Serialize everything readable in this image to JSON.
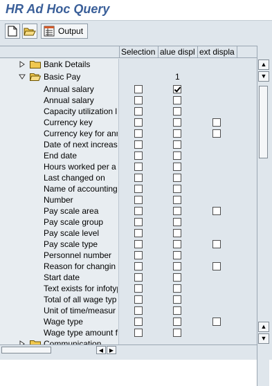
{
  "window": {
    "title": "HR Ad Hoc Query"
  },
  "toolbar": {
    "new_icon": "new-document-icon",
    "open_icon": "open-folder-icon",
    "output_icon": "output-list-icon",
    "output_label": "Output"
  },
  "columns": {
    "selection": "Selection",
    "value_display": "alue displ",
    "text_display": "ext displa"
  },
  "tree": {
    "bank_details": "Bank Details",
    "basic_pay": "Basic Pay",
    "basic_pay_count": "1",
    "communication": "Communication"
  },
  "fields": [
    {
      "label": "Annual salary",
      "selection": false,
      "value": true,
      "text": null
    },
    {
      "label": "Annual salary",
      "selection": false,
      "value": false,
      "text": null
    },
    {
      "label": "Capacity utilization l",
      "selection": false,
      "value": false,
      "text": null
    },
    {
      "label": "Currency key",
      "selection": false,
      "value": false,
      "text": false
    },
    {
      "label": "Currency key for ann",
      "selection": false,
      "value": false,
      "text": false
    },
    {
      "label": "Date of next increas",
      "selection": false,
      "value": false,
      "text": null
    },
    {
      "label": "End date",
      "selection": false,
      "value": false,
      "text": null
    },
    {
      "label": "Hours worked per a",
      "selection": false,
      "value": false,
      "text": null
    },
    {
      "label": "Last changed on",
      "selection": false,
      "value": false,
      "text": null
    },
    {
      "label": "Name of accounting",
      "selection": false,
      "value": false,
      "text": null
    },
    {
      "label": "Number",
      "selection": false,
      "value": false,
      "text": null
    },
    {
      "label": "Pay scale area",
      "selection": false,
      "value": false,
      "text": false
    },
    {
      "label": "Pay scale group",
      "selection": false,
      "value": false,
      "text": null
    },
    {
      "label": "Pay scale level",
      "selection": false,
      "value": false,
      "text": null
    },
    {
      "label": "Pay scale type",
      "selection": false,
      "value": false,
      "text": false
    },
    {
      "label": "Personnel number",
      "selection": false,
      "value": false,
      "text": null
    },
    {
      "label": "Reason for changin",
      "selection": false,
      "value": false,
      "text": false
    },
    {
      "label": "Start date",
      "selection": false,
      "value": false,
      "text": null
    },
    {
      "label": "Text exists for infotyp",
      "selection": false,
      "value": false,
      "text": null
    },
    {
      "label": "Total of all wage typ",
      "selection": false,
      "value": false,
      "text": null
    },
    {
      "label": "Unit of time/measur",
      "selection": false,
      "value": false,
      "text": null
    },
    {
      "label": "Wage type",
      "selection": false,
      "value": false,
      "text": false
    },
    {
      "label": "Wage type amount f",
      "selection": false,
      "value": false,
      "text": null
    }
  ],
  "colors": {
    "title": "#3a5f99",
    "background": "#dfe6ec",
    "folder": "#f0c850"
  }
}
